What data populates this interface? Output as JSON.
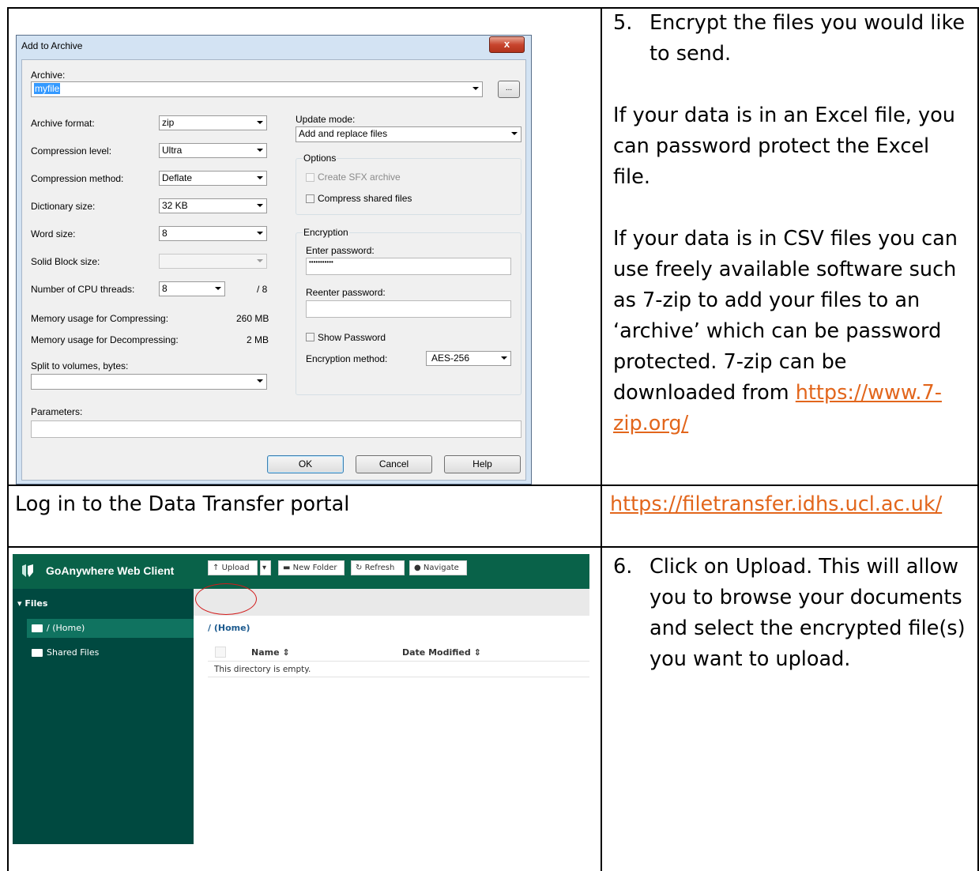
{
  "step5": {
    "number": "5.",
    "text": "Encrypt the files you would like to send.",
    "excel_text": "If your data is in an Excel file, you can password protect the Excel file.",
    "csv_text": "If your data is in CSV files you can use freely available software such as 7-zip to add your files to an ‘archive’ which can be password protected. 7-zip can be downloaded from",
    "link": "https://www.7-zip.org/"
  },
  "login": {
    "text": "Log in to the Data Transfer portal",
    "link": "https://filetransfer.idhs.ucl.ac.uk/"
  },
  "step6": {
    "number": "6.",
    "text": "Click on Upload. This will allow you to browse your documents and select the encrypted file(s) you want to upload."
  },
  "dialog": {
    "title": "Add to Archive",
    "close_glyph": "x",
    "archive_label": "Archive:",
    "archive_value": "myfile",
    "browse_label": "...",
    "archive_format_label": "Archive format:",
    "archive_format_value": "zip",
    "compression_level_label": "Compression level:",
    "compression_level_value": "Ultra",
    "compression_method_label": "Compression method:",
    "compression_method_value": "Deflate",
    "dictionary_size_label": "Dictionary size:",
    "dictionary_size_value": "32 KB",
    "word_size_label": "Word size:",
    "word_size_value": "8",
    "solid_block_label": "Solid Block size:",
    "solid_block_value": "",
    "cpu_threads_label": "Number of CPU threads:",
    "cpu_threads_value": "8",
    "cpu_threads_max": "/ 8",
    "mem_compress_label": "Memory usage for Compressing:",
    "mem_compress_value": "260 MB",
    "mem_decompress_label": "Memory usage for Decompressing:",
    "mem_decompress_value": "2 MB",
    "split_label": "Split to volumes, bytes:",
    "split_value": "",
    "parameters_label": "Parameters:",
    "parameters_value": "",
    "update_mode_label": "Update mode:",
    "update_mode_value": "Add and replace files",
    "options_label": "Options",
    "create_sfx_label": "Create SFX archive",
    "compress_shared_label": "Compress shared files",
    "encryption_label": "Encryption",
    "enter_password_label": "Enter password:",
    "password_value": "•••••••••••",
    "reenter_password_label": "Reenter password:",
    "show_password_label": "Show Password",
    "encryption_method_label": "Encryption method:",
    "encryption_method_value": "AES-256",
    "ok_label": "OK",
    "cancel_label": "Cancel",
    "help_label": "Help"
  },
  "goanywhere": {
    "brand": "GoAnywhere Web Client",
    "page_title": "Files",
    "sidebar_header": "Files",
    "sidebar_items": [
      "/ (Home)",
      "Shared Files"
    ],
    "toolbar": {
      "upload": "Upload",
      "new_folder": "New Folder",
      "refresh": "Refresh",
      "navigate": "Navigate"
    },
    "breadcrumb": "/ (Home)",
    "columns": {
      "name": "Name",
      "date_modified": "Date Modified"
    },
    "empty_message": "This directory is empty.",
    "colors": {
      "header": "#096249",
      "sidebar": "#004940",
      "highlight": "#d21b1b"
    }
  },
  "link_color": "#e2661c"
}
